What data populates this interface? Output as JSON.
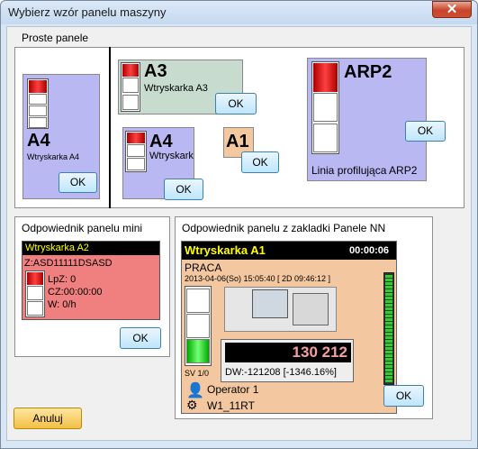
{
  "window": {
    "title": "Wybierz wzór panelu maszyny",
    "close_symbol": "✕"
  },
  "simple": {
    "label": "Proste panele",
    "a4_big": {
      "code": "A4",
      "name": "Wtryskarka A4",
      "ok": "OK"
    },
    "a3": {
      "code": "A3",
      "name": "Wtryskarka A3",
      "ok": "OK"
    },
    "a4_small": {
      "code": "A4",
      "name": "Wtryskark",
      "ok": "OK"
    },
    "a1": {
      "code": "A1",
      "ok": "OK"
    },
    "arp2": {
      "code": "ARP2",
      "name": "Linia profilująca ARP2",
      "ok": "OK"
    }
  },
  "mini": {
    "label": "Odpowiednik panelu mini",
    "header": "Wtryskarka A2",
    "id": "Z:ASD11111DSASD",
    "lpz": "LpZ: 0",
    "cz": "CZ:00:00:00",
    "w": "W: 0/h",
    "ok": "OK"
  },
  "nn": {
    "label": "Odpowiednik panelu z zakladki Panele NN",
    "header": "Wtryskarka A1",
    "timer": "00:00:06",
    "status": "PRACA",
    "datetime": "2013-04-06(So) 15:05:40",
    "duration": "[ 2D 09:46:12 ]",
    "counter": "130 212",
    "dw": "DW:-121208 [-1346.16%]",
    "sv": "SV 1/0",
    "operator": "Operator 1",
    "product": "W1_11RT",
    "ok": "OK"
  },
  "cancel_label": "Anuluj",
  "colors": {
    "panel_blue": "#b9b8f2",
    "panel_green": "#c7dbcf",
    "panel_orange": "#f3c8a0",
    "mini_red": "#f08080",
    "header_yellow": "#ffff00"
  }
}
